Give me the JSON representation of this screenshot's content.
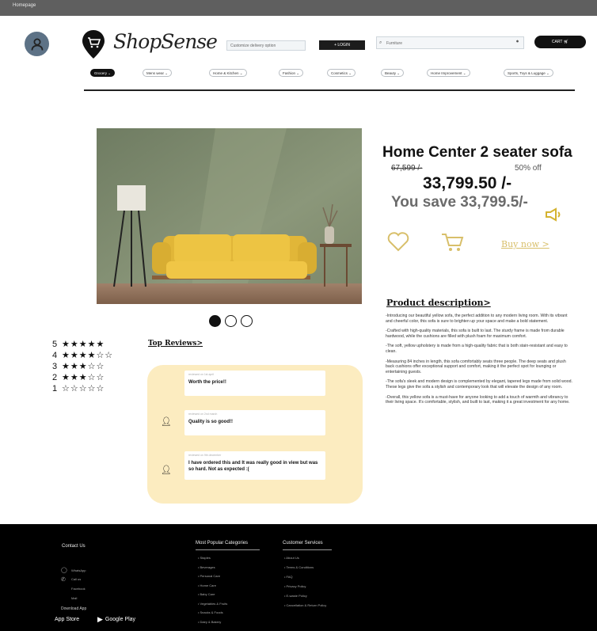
{
  "window": {
    "title": "Homepage"
  },
  "header": {
    "brand": "ShopSense",
    "location_placeholder": "Customize delivery option",
    "login_label": "+ LOGIN",
    "search_placeholder": "Furniture",
    "cart_label": "CART"
  },
  "nav": {
    "categories": [
      "Grocery",
      "Mens wear",
      "Home & Kitchen",
      "Fashion",
      "Cosmetics",
      "Beauty",
      "Home Improvement",
      "Sports, Toys & Luggage"
    ],
    "active_index": 0
  },
  "product": {
    "title": "Home Center  2 seater sofa",
    "mrp": "67,599 /-",
    "discount": "50% off",
    "price": "33,799.50 /-",
    "savings": "You save 33,799.5/-",
    "buy_label": "Buy now >"
  },
  "carousel": {
    "count": 3,
    "active": 0
  },
  "ratings": [
    {
      "label": "5",
      "stars": "★★★★★"
    },
    {
      "label": "4",
      "stars": "★★★★☆☆"
    },
    {
      "label": "3",
      "stars": "★★★☆☆"
    },
    {
      "label": "2",
      "stars": "★★★☆☆"
    },
    {
      "label": "1",
      "stars": "☆☆☆☆☆"
    }
  ],
  "reviews": {
    "title": "Top Reviews>",
    "items": [
      {
        "meta": "reviewed on 1st april",
        "text": "Worth the price!!"
      },
      {
        "meta": "reviewed on 2nd march",
        "text": "Quality is so good!!"
      },
      {
        "meta": "reviewed on 9th december",
        "text": "I have ordered this and It was really good in view but was so hard. Not as expected :("
      }
    ]
  },
  "description": {
    "title": "Product description>",
    "paragraphs": [
      "-Introducing our beautiful yellow sofa, the perfect addition to any modern living room. With its vibrant and cheerful color, this sofa is sure to brighten up your space and make a bold statement.",
      "-Crafted with high-quality materials, this sofa is built to last. The sturdy frame is made from durable hardwood, while the cushions are filled with plush foam for maximum comfort.",
      "-The soft, yellow upholstery is made from a high-quality fabric that is both stain-resistant and easy to clean.",
      "-Measuring 84 inches in length, this sofa comfortably seats three people. The deep seats and plush back cushions offer exceptional support and comfort, making it the perfect spot for lounging or entertaining guests.",
      "-The sofa's sleek and modern design is complemented by elegant, tapered legs made from solid wood. These legs give the sofa a stylish and contemporary look that will elevate the design of any room.",
      "-Overall, this yellow sofa is a must-have for anyone looking to add a touch of warmth and vibrancy to their living space. It's comfortable, stylish, and built to last, making it a great investment for any home."
    ]
  },
  "footer": {
    "contact_title": "Contact Us",
    "contact_items": [
      "WhatsApp",
      "Call us",
      "Facebook",
      "Mail"
    ],
    "download_title": "Download App",
    "app_store": "App Store",
    "google_play": "Google Play",
    "popular_title": "Most Popular Categories",
    "popular_items": [
      "Staples",
      "Beverages",
      "Personal Care",
      "Home Care",
      "Baby Care",
      "Vegetables & Fruits",
      "Snacks & Foods",
      "Dairy & Bakery"
    ],
    "service_title": "Customer Services",
    "service_items": [
      "About Us",
      "Terms & Conditions",
      "FAQ",
      "Privacy Policy",
      "E-waste Policy",
      "Cancellation & Return Policy"
    ]
  },
  "colors": {
    "accent_yellow": "#d8bf6a",
    "review_panel": "#fcecc0",
    "footer_bg": "#000000"
  }
}
